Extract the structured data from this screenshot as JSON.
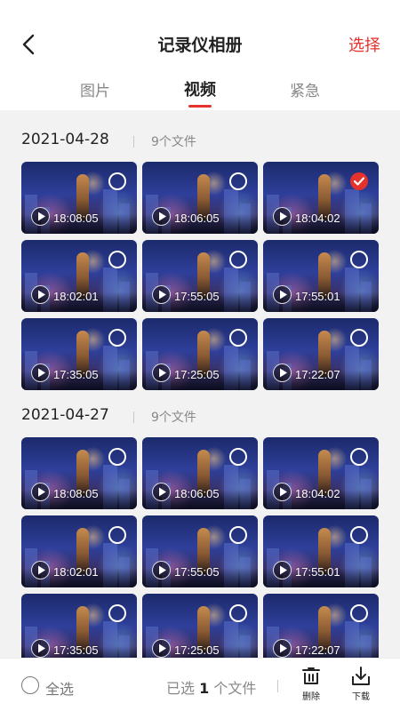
{
  "header": {
    "title": "记录仪相册",
    "select_label": "选择"
  },
  "tabs": [
    {
      "label": "图片",
      "active": false
    },
    {
      "label": "视频",
      "active": true
    },
    {
      "label": "紧急",
      "active": false
    }
  ],
  "sections": [
    {
      "date": "2021-04-28",
      "count": "9个文件",
      "items": [
        {
          "time": "18:08:05",
          "selected": false
        },
        {
          "time": "18:06:05",
          "selected": false
        },
        {
          "time": "18:04:02",
          "selected": true
        },
        {
          "time": "18:02:01",
          "selected": false
        },
        {
          "time": "17:55:05",
          "selected": false
        },
        {
          "time": "17:55:01",
          "selected": false
        },
        {
          "time": "17:35:05",
          "selected": false
        },
        {
          "time": "17:25:05",
          "selected": false
        },
        {
          "time": "17:22:07",
          "selected": false
        }
      ]
    },
    {
      "date": "2021-04-27",
      "count": "9个文件",
      "items": [
        {
          "time": "18:08:05",
          "selected": false
        },
        {
          "time": "18:06:05",
          "selected": false
        },
        {
          "time": "18:04:02",
          "selected": false
        },
        {
          "time": "18:02:01",
          "selected": false
        },
        {
          "time": "17:55:05",
          "selected": false
        },
        {
          "time": "17:55:01",
          "selected": false
        },
        {
          "time": "17:35:05",
          "selected": false
        },
        {
          "time": "17:25:05",
          "selected": false
        },
        {
          "time": "17:22:07",
          "selected": false
        }
      ]
    }
  ],
  "bottom_bar": {
    "select_all_label": "全选",
    "selected_prefix": "已选",
    "selected_count": "1",
    "selected_suffix": "个文件",
    "delete_label": "删除",
    "download_label": "下载"
  },
  "colors": {
    "accent": "#e5322d",
    "background": "#f2f2f2"
  }
}
